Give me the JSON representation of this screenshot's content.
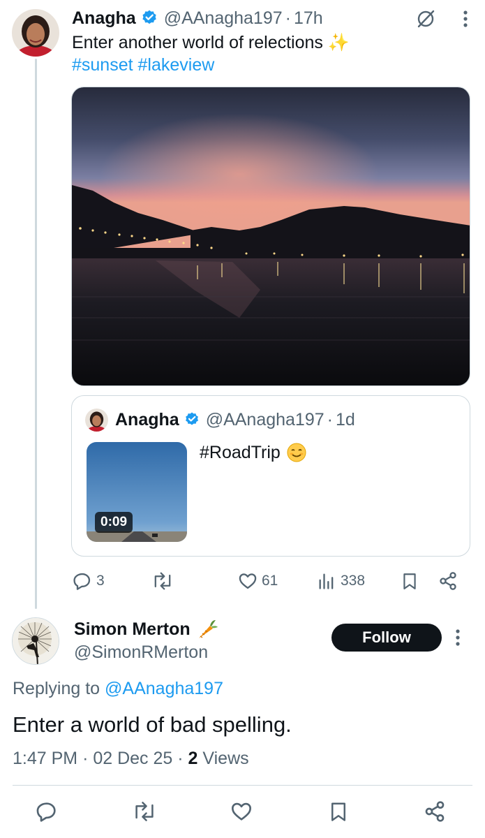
{
  "tweet": {
    "author_name": "Anagha",
    "author_handle": "@AAnagha197",
    "separator": "·",
    "time": "17h",
    "text": "Enter another world of relections ✨",
    "hashtags": [
      "#sunset",
      "#lakeview"
    ]
  },
  "quoted_tweet": {
    "author_name": "Anagha",
    "author_handle": "@AAnagha197",
    "separator": "·",
    "time": "1d",
    "text": "#RoadTrip",
    "video_duration": "0:09"
  },
  "actions": {
    "replies": "3",
    "reposts": "",
    "likes": "61",
    "views": "338"
  },
  "reply": {
    "author_name": "Simon Merton",
    "author_handle": "@SimonRMerton",
    "follow_label": "Follow",
    "replying_prefix": "Replying to",
    "replying_to": "@AAnagha197",
    "text": "Enter a world of bad spelling.",
    "time": "1:47 PM",
    "date": "02 Dec 25",
    "views_count": "2",
    "views_label": "Views"
  },
  "icons": {
    "verified": "verified-badge-icon",
    "grok": "grok-icon",
    "more": "more-vertical-icon",
    "reply": "reply-icon",
    "repost": "repost-icon",
    "like": "like-icon",
    "views": "views-icon",
    "bookmark": "bookmark-icon",
    "share": "share-icon"
  },
  "colors": {
    "accent": "#1d9bf0",
    "text": "#0f1419",
    "muted": "#536471",
    "border": "#cfd9de"
  }
}
